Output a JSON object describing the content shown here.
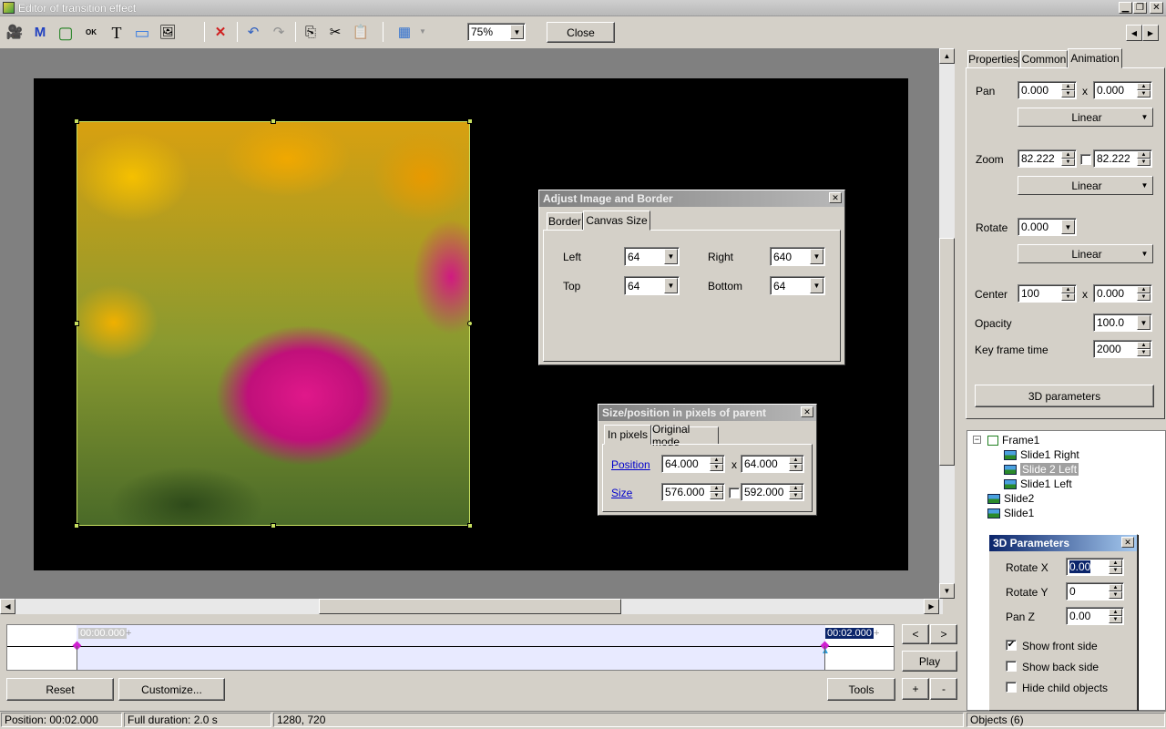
{
  "window": {
    "title": "Editor of transition effect",
    "controls": {
      "minimize": "▁",
      "restore": "❐",
      "close": "✕"
    }
  },
  "toolbar": {
    "icons": [
      {
        "name": "camera-icon",
        "glyph": "🎥"
      },
      {
        "name": "mask-icon",
        "glyph": "M"
      },
      {
        "name": "frame-icon",
        "glyph": "▢"
      },
      {
        "name": "ok-button-icon",
        "glyph": "OK"
      },
      {
        "name": "text-icon",
        "glyph": "T"
      },
      {
        "name": "rectangle-icon",
        "glyph": "▭"
      },
      {
        "name": "image-icon",
        "glyph": "🖼"
      }
    ],
    "delete_glyph": "✕",
    "undo_glyph": "↶",
    "redo_glyph": "↷",
    "copy_glyph": "⎘",
    "cut_glyph": "✂",
    "paste_glyph": "📋",
    "grid_glyph": "▦",
    "zoom_value": "75%",
    "close_label": "Close",
    "nav_prev": "◀",
    "nav_next": "▶"
  },
  "adjust_panel": {
    "title": "Adjust Image and Border",
    "tabs": [
      "Border",
      "Canvas Size"
    ],
    "left_label": "Left",
    "left_value": "64",
    "right_label": "Right",
    "right_value": "640",
    "top_label": "Top",
    "top_value": "64",
    "bottom_label": "Bottom",
    "bottom_value": "64"
  },
  "size_panel": {
    "title": "Size/position in pixels of parent",
    "tabs": [
      "In pixels",
      "Original mode"
    ],
    "position_label": "Position",
    "position_x": "64.000",
    "position_y": "64.000",
    "size_label": "Size",
    "size_w": "576.000",
    "size_h": "592.000",
    "x_sep": "x"
  },
  "right_panel": {
    "tabs": [
      "Properties",
      "Common",
      "Animation"
    ],
    "pan_label": "Pan",
    "pan_x": "0.000",
    "pan_y": "0.000",
    "pan_mode": "Linear",
    "zoom_label": "Zoom",
    "zoom_x": "82.222",
    "zoom_y": "82.222",
    "zoom_mode": "Linear",
    "rotate_label": "Rotate",
    "rotate_value": "0.000",
    "rotate_mode": "Linear",
    "center_label": "Center",
    "center_x": "100",
    "center_y": "0.000",
    "opacity_label": "Opacity",
    "opacity_value": "100.0",
    "keyframe_label": "Key frame time",
    "keyframe_value": "2000",
    "params3d_label": "3D parameters",
    "x_sep": "x"
  },
  "tree": {
    "items": [
      {
        "label": "Frame1"
      },
      {
        "label": "Slide1 Right"
      },
      {
        "label": "Slide 2 Left"
      },
      {
        "label": "Slide1 Left"
      },
      {
        "label": "Slide2"
      },
      {
        "label": "Slide1"
      }
    ]
  },
  "params3d_panel": {
    "title": "3D Parameters",
    "rotate_x_label": "Rotate X",
    "rotate_x_value": "0.00",
    "rotate_y_label": "Rotate Y",
    "rotate_y_value": "0",
    "pan_z_label": "Pan Z",
    "pan_z_value": "0.00",
    "show_front_label": "Show front side",
    "show_back_label": "Show back side",
    "hide_child_label": "Hide child objects",
    "show_front_checked": true,
    "show_back_checked": false,
    "hide_child_checked": false
  },
  "timeline": {
    "start_time": "00:00.000",
    "end_time": "00:02.000",
    "plus": "+",
    "prev_label": "<",
    "next_label": ">",
    "play_label": "Play",
    "plus_label": "+",
    "minus_label": "-"
  },
  "bottom_buttons": {
    "reset_label": "Reset",
    "customize_label": "Customize...",
    "tools_label": "Tools"
  },
  "status": {
    "position": "Position:  00:02.000",
    "duration": "Full duration:  2.0 s",
    "resolution": "1280, 720",
    "objects": "Objects (6)"
  },
  "colors": {
    "accent_titlebar": "#0a246a",
    "selection": "#0a246a",
    "canvas_bg": "#000000",
    "workspace_bg": "#808080"
  }
}
